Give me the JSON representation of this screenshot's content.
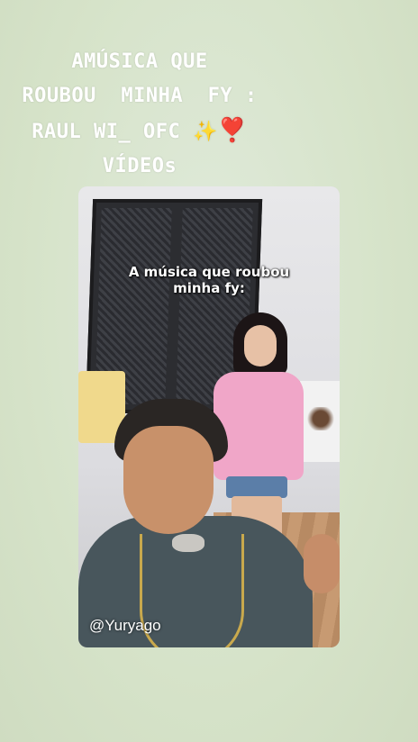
{
  "story": {
    "headline": {
      "line1": "AMÚSICA QUE",
      "line2": "ROUBOU  MINHA  FY :",
      "line3": "RAUL WI_ OFC",
      "line3_emoji_sparkle": "✨",
      "line3_emoji_heart": "❣️",
      "line4": "VÍDEOs"
    },
    "video": {
      "caption_line1": "A música que roubou",
      "caption_line2": "minha fy:",
      "handle": "@Yuryago"
    }
  }
}
